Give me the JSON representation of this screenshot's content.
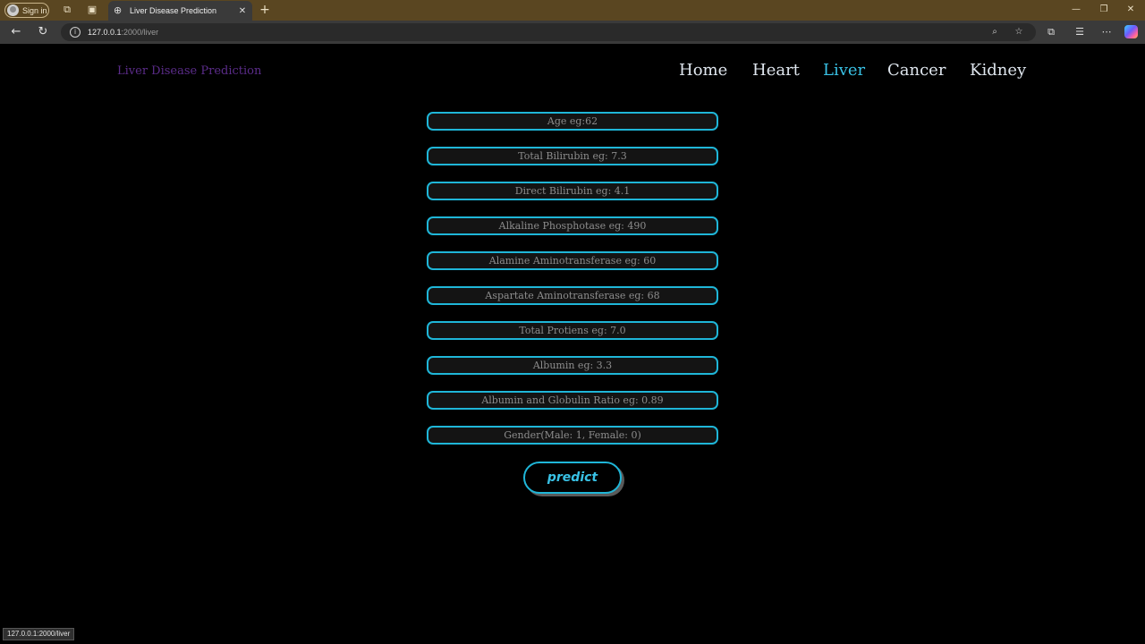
{
  "browser": {
    "signin_label": "Sign in",
    "tab_title": "Liver Disease Prediction",
    "url_host": "127.0.0.1",
    "url_rest": ":2000/liver",
    "status_url": "127.0.0.1:2000/liver",
    "icons": {
      "workspaces": "⧉",
      "tab_actions": "▣",
      "globe": "⊕",
      "close_tab": "✕",
      "new_tab": "+",
      "minimize": "—",
      "restore": "❐",
      "close_window": "✕",
      "back": "←",
      "reload": "↻",
      "info": "i",
      "zoom": "⌕",
      "favorite": "☆",
      "split": "⧉",
      "favorites": "☰",
      "more": "⋯"
    }
  },
  "header": {
    "brand": "Liver Disease Prediction",
    "nav": [
      {
        "label": "Home",
        "active": false
      },
      {
        "label": "Heart",
        "active": false
      },
      {
        "label": "Liver",
        "active": true
      },
      {
        "label": "Cancer",
        "active": false
      },
      {
        "label": "Kidney",
        "active": false
      }
    ]
  },
  "form": {
    "fields": [
      {
        "placeholder": "Age eg:62"
      },
      {
        "placeholder": "Total Bilirubin eg: 7.3"
      },
      {
        "placeholder": "Direct Bilirubin eg: 4.1"
      },
      {
        "placeholder": "Alkaline Phosphotase eg: 490"
      },
      {
        "placeholder": "Alamine Aminotransferase eg: 60"
      },
      {
        "placeholder": "Aspartate Aminotransferase eg: 68"
      },
      {
        "placeholder": "Total Protiens eg: 7.0"
      },
      {
        "placeholder": "Albumin eg: 3.3"
      },
      {
        "placeholder": "Albumin and Globulin Ratio eg: 0.89"
      },
      {
        "placeholder": "Gender(Male: 1, Female: 0)"
      }
    ],
    "submit_label": "predict"
  },
  "colors": {
    "accent": "#39c2e6",
    "brand": "#5b2c8a",
    "titlebar": "#5a4621",
    "background": "#000000"
  }
}
